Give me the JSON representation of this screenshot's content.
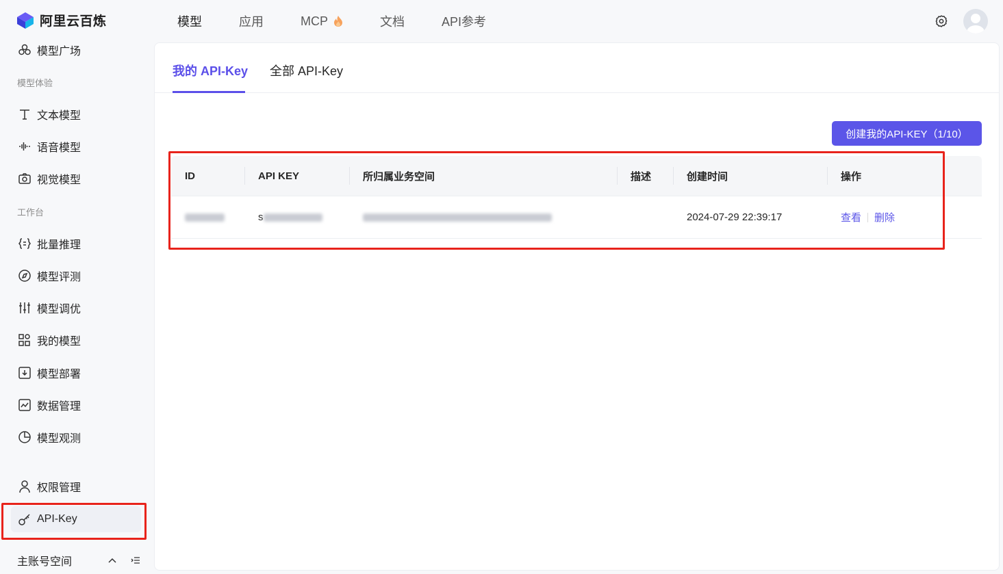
{
  "brand": {
    "name": "阿里云百炼"
  },
  "nav": [
    {
      "label": "模型",
      "active": true
    },
    {
      "label": "应用",
      "active": false
    },
    {
      "label": "MCP",
      "active": false,
      "badge_icon": "flame-icon"
    },
    {
      "label": "文档",
      "active": false
    },
    {
      "label": "API参考",
      "active": false
    }
  ],
  "sidebar": {
    "top_item": {
      "label": "模型广场",
      "icon": "model-square-icon"
    },
    "section_experience": "模型体验",
    "experience_items": [
      {
        "label": "文本模型",
        "icon": "text-icon"
      },
      {
        "label": "语音模型",
        "icon": "waveform-icon"
      },
      {
        "label": "视觉模型",
        "icon": "camera-icon"
      }
    ],
    "section_workbench": "工作台",
    "workbench_items": [
      {
        "label": "批量推理",
        "icon": "braces-icon"
      },
      {
        "label": "模型评测",
        "icon": "compass-icon"
      },
      {
        "label": "模型调优",
        "icon": "sliders-icon"
      },
      {
        "label": "我的模型",
        "icon": "grid-icon"
      },
      {
        "label": "模型部署",
        "icon": "download-box-icon"
      },
      {
        "label": "数据管理",
        "icon": "chart-box-icon"
      },
      {
        "label": "模型观测",
        "icon": "pie-icon"
      }
    ],
    "permission": {
      "label": "权限管理",
      "icon": "user-icon"
    },
    "apikey": {
      "label": "API-Key",
      "icon": "key-icon",
      "active": true
    },
    "workspace": {
      "label": "主账号空间"
    }
  },
  "main": {
    "tabs": [
      {
        "label": "我的 API-Key",
        "active": true
      },
      {
        "label": "全部 API-Key",
        "active": false
      }
    ],
    "create_button": "创建我的API-KEY（1/10）",
    "table": {
      "columns": [
        "ID",
        "API KEY",
        "所归属业务空间",
        "描述",
        "创建时间",
        "操作"
      ],
      "rows": [
        {
          "id": "",
          "api_key": "s",
          "workspace": "",
          "description": "",
          "created_at": "2024-07-29 22:39:17",
          "actions": [
            "查看",
            "删除"
          ]
        }
      ]
    }
  },
  "colors": {
    "accent": "#5b55e8",
    "highlight_frame": "#e8231b"
  }
}
